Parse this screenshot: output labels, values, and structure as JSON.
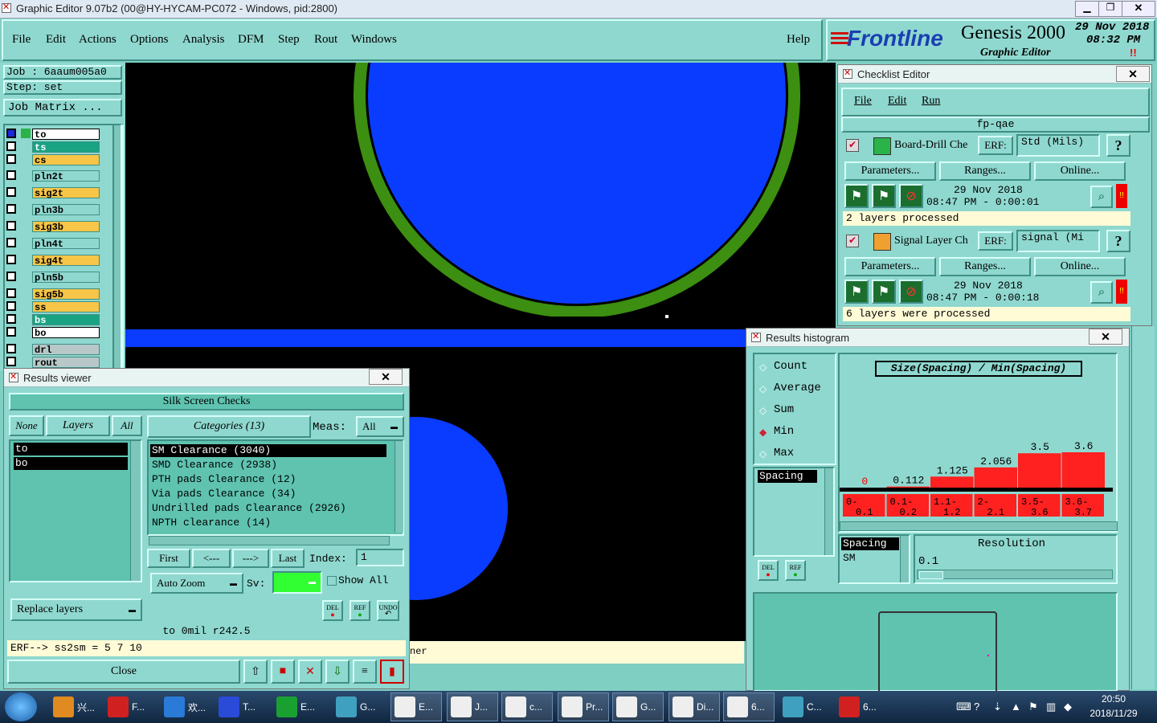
{
  "window_title": "Graphic Editor 9.07b2 (00@HY-HYCAM-PC072 - Windows, pid:2800)",
  "menu": [
    "File",
    "Edit",
    "Actions",
    "Options",
    "Analysis",
    "DFM",
    "Step",
    "Rout",
    "Windows"
  ],
  "help": "Help",
  "brand": {
    "logo": "Frontline",
    "product": "Genesis 2000",
    "subtitle": "Graphic Editor",
    "date": "29 Nov 2018",
    "time": "08:32 PM",
    "marker": "!!"
  },
  "job": {
    "job": "Job : 6aaum005a0",
    "step": "Step: set",
    "matrix_btn": "Job Matrix ..."
  },
  "layers": [
    {
      "name": "to",
      "color": "#ffffff"
    },
    {
      "name": "ts",
      "color": "#1aa383"
    },
    {
      "name": "cs",
      "color": "#f7c548"
    },
    {
      "name": "pln2t",
      "color": "#8fd8cf"
    },
    {
      "name": "sig2t",
      "color": "#f7c548"
    },
    {
      "name": "pln3b",
      "color": "#8fd8cf"
    },
    {
      "name": "sig3b",
      "color": "#f7c548"
    },
    {
      "name": "pln4t",
      "color": "#8fd8cf"
    },
    {
      "name": "sig4t",
      "color": "#f7c548"
    },
    {
      "name": "pln5b",
      "color": "#8fd8cf"
    },
    {
      "name": "sig5b",
      "color": "#f7c548"
    },
    {
      "name": "ss",
      "color": "#f7c548"
    },
    {
      "name": "bs",
      "color": "#1aa383"
    },
    {
      "name": "bo",
      "color": "#ffffff"
    },
    {
      "name": "drl",
      "color": "#b8c8c8"
    },
    {
      "name": "rout",
      "color": "#b8c8c8"
    }
  ],
  "checklist": {
    "title": "Checklist Editor",
    "menu": [
      "File",
      "Edit",
      "Run"
    ],
    "name": "fp-qae",
    "items": [
      {
        "name": "Board-Drill Che",
        "erf_label": "ERF:",
        "erf_value": "Std (Mils)",
        "help": "?",
        "params": "Parameters...",
        "ranges": "Ranges...",
        "online": "Online...",
        "date": "29 Nov 2018",
        "time": "08:47 PM - 0:00:01",
        "status": "2 layers processed"
      },
      {
        "name": "Signal Layer Ch",
        "erf_label": "ERF:",
        "erf_value": "signal (Mi",
        "help": "?",
        "params": "Parameters...",
        "ranges": "Ranges...",
        "online": "Online...",
        "date": "29 Nov 2018",
        "time": "08:47 PM - 0:00:18",
        "status": "6 layers were processed"
      }
    ]
  },
  "results_viewer": {
    "title": "Results viewer",
    "header": "Silk Screen Checks",
    "none": "None",
    "layers": "Layers",
    "all": "All",
    "categories_btn": "Categories (13)",
    "meas_label": "Meas:",
    "meas_value": "All",
    "layer_list": [
      "to",
      "bo"
    ],
    "categories": [
      "SM Clearance (3040)",
      "SMD Clearance (2938)",
      "PTH pads Clearance (12)",
      "Via pads Clearance (34)",
      "Undrilled pads Clearance (2926)",
      "NPTH clearance (14)"
    ],
    "first": "First",
    "prev": "<---",
    "next": "--->",
    "last": "Last",
    "index_label": "Index:",
    "index_value": "1",
    "auto_zoom": "Auto Zoom",
    "sv_label": "Sv:",
    "show_all": "Show All",
    "replace": "Replace layers",
    "small_btns": [
      "DEL",
      "REF",
      "UNDO"
    ],
    "info": "to 0mil  r242.5",
    "erf": "ERF--> ss2sm = 5 7 10",
    "close": "Close"
  },
  "status_text": "ner",
  "histogram": {
    "title": "Results histogram",
    "options": [
      "Count",
      "Average",
      "Sum",
      "Min",
      "Max"
    ],
    "selected": "Min",
    "chart_title": "Size(Spacing) / Min(Spacing)",
    "list": [
      "Spacing"
    ],
    "sub_list": [
      "Spacing",
      "SM"
    ],
    "resolution_label": "Resolution",
    "resolution_value": "0.1",
    "btns": [
      "DEL",
      "REF"
    ]
  },
  "chart_data": {
    "type": "bar",
    "categories": [
      "0-\n0.1",
      "0.1-\n0.2",
      "1.1-\n1.2",
      "2-\n2.1",
      "3.5-\n3.6",
      "3.6-\n3.7"
    ],
    "values": [
      0,
      0.112,
      1.125,
      2.056,
      3.5,
      3.6
    ],
    "labels": [
      "0",
      "0.112",
      "1.125",
      "2.056",
      "3.5",
      "3.6"
    ],
    "title": "Size(Spacing) / Min(Spacing)",
    "bar_color": "#ff2020"
  },
  "taskbar": {
    "items": [
      "兴...",
      "F...",
      "欢...",
      "T...",
      "E...",
      "G...",
      "E...",
      "J...",
      "c...",
      "Pr...",
      "G...",
      "Di...",
      "6...",
      "C...",
      "6..."
    ],
    "clock_time": "20:50",
    "clock_date": "2018/11/29"
  }
}
